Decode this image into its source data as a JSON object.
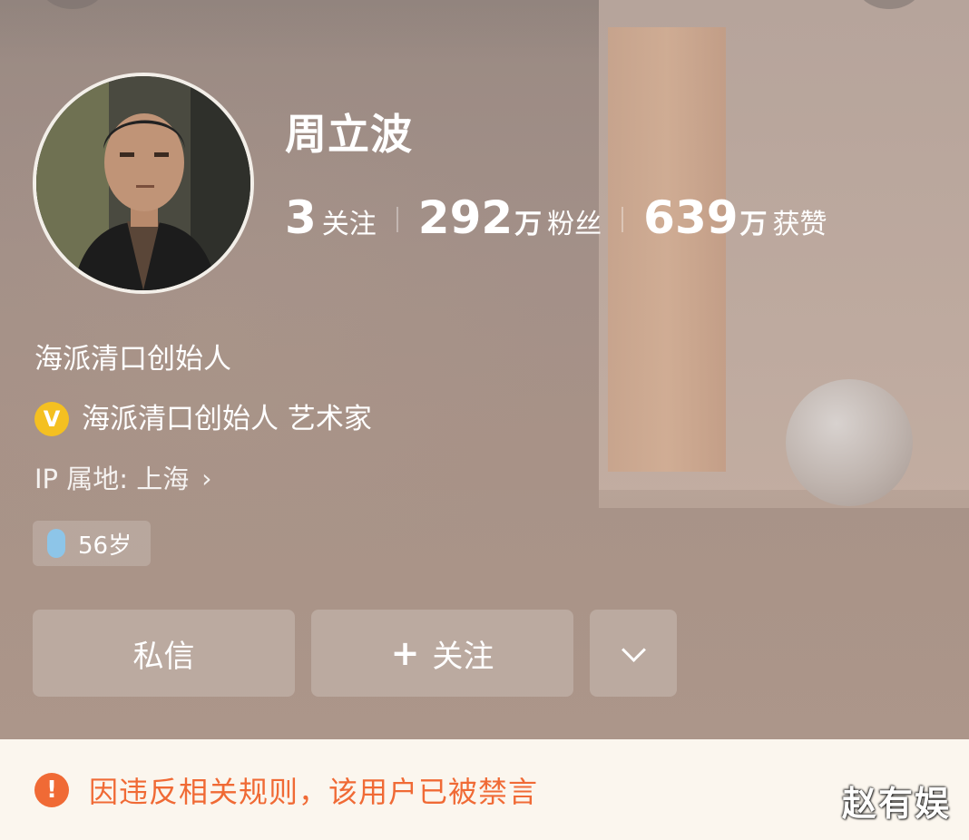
{
  "profile": {
    "name": "周立波",
    "avatar_icon": "profile-photo",
    "stats": [
      {
        "num": "3",
        "unit": "",
        "label": "关注"
      },
      {
        "num": "292",
        "unit": "万",
        "label": "粉丝"
      },
      {
        "num": "639",
        "unit": "万",
        "label": "获赞"
      }
    ],
    "bio": "海派清口创始人",
    "verification": {
      "badge": "V",
      "text": "海派清口创始人 艺术家",
      "color": "#f4c021"
    },
    "ip_location": "IP 属地: 上海",
    "age_tag": "56岁"
  },
  "actions": {
    "message_label": "私信",
    "follow_plus": "+",
    "follow_label": "关注",
    "more_icon": "chevron-down-icon"
  },
  "notice": {
    "icon": "!",
    "text": "因违反相关规则，该用户已被禁言",
    "color": "#f06a35"
  },
  "watermark": "赵有娱"
}
